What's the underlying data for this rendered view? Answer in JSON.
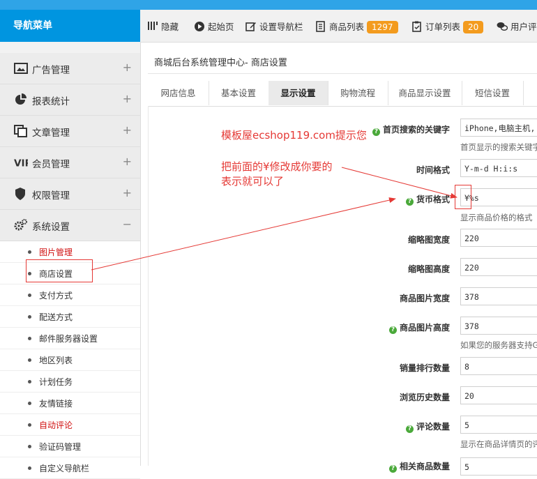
{
  "sidebar": {
    "title": "导航菜单",
    "menu": [
      {
        "label": "广告管理",
        "toggle": "+"
      },
      {
        "label": "报表统计",
        "toggle": "+"
      },
      {
        "label": "文章管理",
        "toggle": "+"
      },
      {
        "label": "会员管理",
        "toggle": "+"
      },
      {
        "label": "权限管理",
        "toggle": "+"
      },
      {
        "label": "系统设置",
        "toggle": "−"
      }
    ],
    "submenu": [
      {
        "label": "图片管理"
      },
      {
        "label": "商店设置"
      },
      {
        "label": "支付方式"
      },
      {
        "label": "配送方式"
      },
      {
        "label": "邮件服务器设置"
      },
      {
        "label": "地区列表"
      },
      {
        "label": "计划任务"
      },
      {
        "label": "友情链接"
      },
      {
        "label": "自动评论"
      },
      {
        "label": "验证码管理"
      },
      {
        "label": "自定义导航栏"
      }
    ]
  },
  "toolbar": {
    "hide": "隐藏",
    "start": "起始页",
    "set_nav": "设置导航栏",
    "goods_list": "商品列表",
    "goods_count": "1297",
    "order_list": "订单列表",
    "order_count": "20",
    "user_comments": "用户评论"
  },
  "breadcrumb": "商城后台系统管理中心- 商店设置",
  "tabs": [
    "网店信息",
    "基本设置",
    "显示设置",
    "购物流程",
    "商品显示设置",
    "短信设置"
  ],
  "form": {
    "search_keywords": {
      "label": "首页搜索的关键字",
      "value": "iPhone,电脑主机,",
      "hint": "首页显示的搜索关键字"
    },
    "time_format": {
      "label": "时间格式",
      "value": "Y-m-d H:i:s"
    },
    "currency_format": {
      "label": "货币格式",
      "value": "¥%s",
      "hint": "显示商品价格的格式"
    },
    "thumb_width": {
      "label": "缩略图宽度",
      "value": "220"
    },
    "thumb_height": {
      "label": "缩略图高度",
      "value": "220"
    },
    "image_width": {
      "label": "商品图片宽度",
      "value": "378"
    },
    "image_height": {
      "label": "商品图片高度",
      "value": "378",
      "hint": "如果您的服务器支持GD"
    },
    "sales_rank": {
      "label": "销量排行数量",
      "value": "8"
    },
    "history": {
      "label": "浏览历史数量",
      "value": "20"
    },
    "comments": {
      "label": "评论数量",
      "value": "5",
      "hint": "显示在商品详情页的评论"
    },
    "related": {
      "label": "相关商品数量",
      "value": "5"
    }
  },
  "annotation": {
    "line1": "模板屋ecshop119.com提示您",
    "line2": "把前面的¥修改成你要的",
    "line3": "表示就可以了"
  },
  "colors": {
    "accent": "#0095e0",
    "badge": "#f39b1e",
    "annotation": "#e53935",
    "help": "#4aa93a"
  }
}
